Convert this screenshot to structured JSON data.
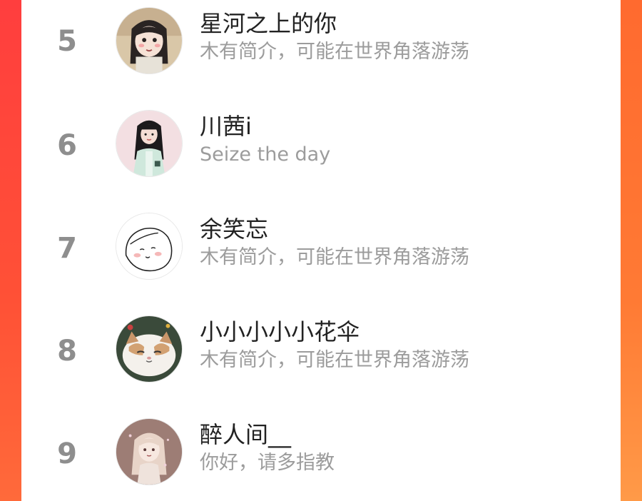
{
  "leaderboard": {
    "rows": [
      {
        "rank": "5",
        "name": "星河之上的你",
        "bio": "木有简介，可能在世界角落游荡",
        "avatar_icon": "girl-cartoon-avatar-icon"
      },
      {
        "rank": "6",
        "name": "川茜i",
        "bio": "Seize the day",
        "avatar_icon": "girl-photo-avatar-icon"
      },
      {
        "rank": "7",
        "name": "余笑忘",
        "bio": "木有简介，可能在世界角落游荡",
        "avatar_icon": "line-drawing-face-avatar-icon"
      },
      {
        "rank": "8",
        "name": "小小小小小花伞",
        "bio": "木有简介，可能在世界角落游荡",
        "avatar_icon": "cat-photo-avatar-icon"
      },
      {
        "rank": "9",
        "name": "醉人间__",
        "bio": "你好，请多指教",
        "avatar_icon": "anime-girl-avatar-icon"
      }
    ]
  },
  "colors": {
    "rank": "#8e8e8e",
    "name": "#222222",
    "bio": "#9c9c9c",
    "background_gradient_start": "#ff4a3d",
    "background_gradient_end": "#ff9440"
  }
}
